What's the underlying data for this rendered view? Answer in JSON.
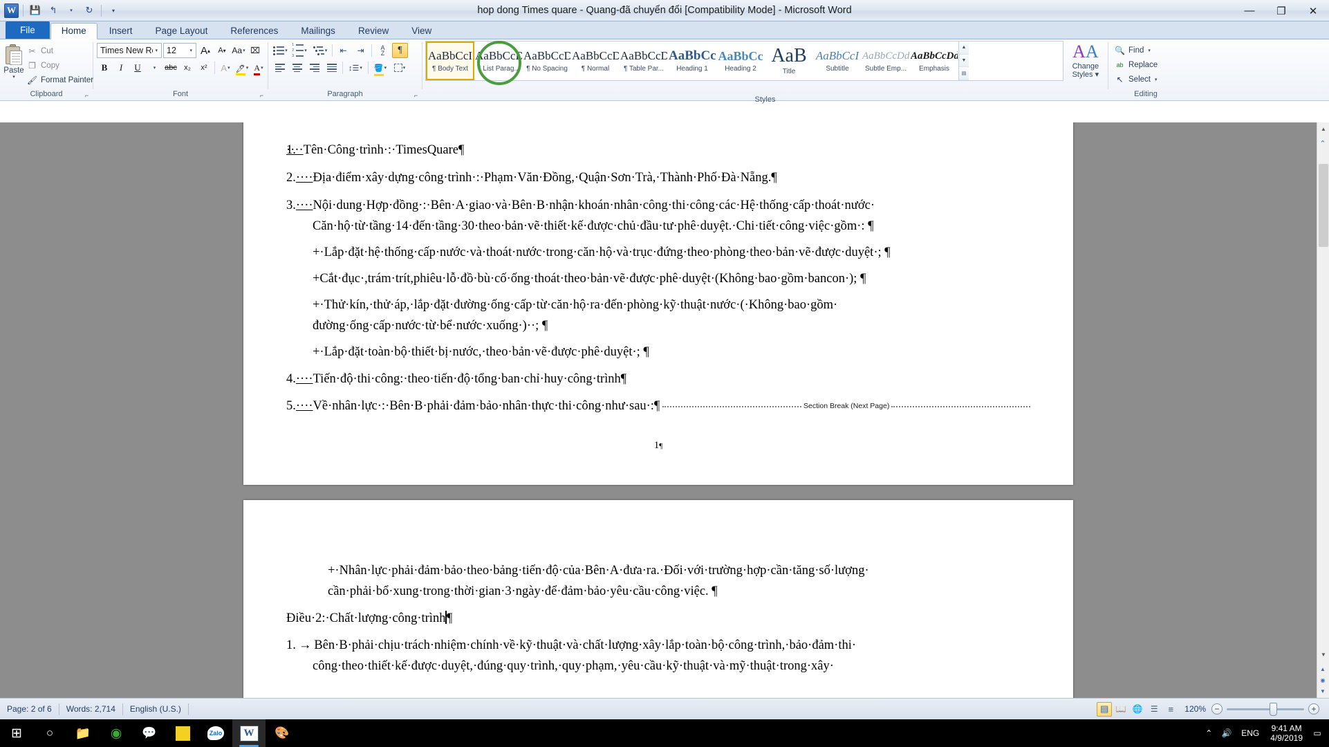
{
  "window": {
    "title": "hop dong Times quare - Quang-đã chuyển đổi [Compatibility Mode]  -  Microsoft Word",
    "minimize": "—",
    "maximize": "❐",
    "close": "✕"
  },
  "quick_access": {
    "app_logo": "W",
    "save": "💾",
    "undo": "↰",
    "undo_caret": "▾",
    "redo": "↻",
    "customize": "▾"
  },
  "tabs": [
    {
      "label": "File",
      "kind": "file"
    },
    {
      "label": "Home",
      "kind": "active"
    },
    {
      "label": "Insert",
      "kind": "normal"
    },
    {
      "label": "Page Layout",
      "kind": "normal"
    },
    {
      "label": "References",
      "kind": "normal"
    },
    {
      "label": "Mailings",
      "kind": "normal"
    },
    {
      "label": "Review",
      "kind": "normal"
    },
    {
      "label": "View",
      "kind": "normal"
    }
  ],
  "ribbon": {
    "clipboard": {
      "group_label": "Clipboard",
      "paste": "Paste",
      "paste_caret": "▾",
      "cut": "Cut",
      "copy": "Copy",
      "format_painter": "Format Painter",
      "cut_icon": "✂",
      "copy_icon": "❐",
      "painter_icon": "🖌",
      "dialog_launcher": "⌐"
    },
    "font": {
      "group_label": "Font",
      "font_name": "Times New Roma",
      "font_size": "12",
      "grow_font": "A",
      "shrink_font": "A",
      "change_case": "Aa",
      "clear_formatting": "⌫",
      "bold": "B",
      "italic": "I",
      "underline": "U",
      "strikethrough": "abc",
      "subscript": "x₂",
      "superscript": "x²",
      "text_effects": "A",
      "highlight": "ab",
      "font_color": "A",
      "dialog_launcher": "⌐"
    },
    "paragraph": {
      "group_label": "Paragraph",
      "bullets": "bullets-icon",
      "numbering": "numbering-icon",
      "multilevel": "multilevel-list-icon",
      "decrease_indent": "decrease-indent-icon",
      "increase_indent": "increase-indent-icon",
      "sort": "A\nZ",
      "show_marks": "¶",
      "align_left": "align-left-icon",
      "align_center": "align-center-icon",
      "align_right": "align-right-icon",
      "justify": "justify-icon",
      "line_spacing": "line-spacing-icon",
      "shading": "shading-icon",
      "borders": "borders-icon",
      "dialog_launcher": "⌐"
    },
    "styles": {
      "group_label": "Styles",
      "items": [
        {
          "preview": "AaBbCcI",
          "name": "¶ Body Text",
          "selected": true,
          "weight": "normal",
          "color": "#1c2b3a",
          "size": "17px"
        },
        {
          "preview": "AaBbCcD",
          "name": "¶ List Parag...",
          "selected": false,
          "weight": "normal",
          "color": "#1c2b3a",
          "size": "17px"
        },
        {
          "preview": "AaBbCcD",
          "name": "¶ No Spacing",
          "selected": false,
          "weight": "normal",
          "color": "#1c2b3a",
          "size": "17px"
        },
        {
          "preview": "AaBbCcD",
          "name": "¶ Normal",
          "selected": false,
          "weight": "normal",
          "color": "#1c2b3a",
          "size": "17px"
        },
        {
          "preview": "AaBbCcD",
          "name": "¶ Table Par...",
          "selected": false,
          "weight": "normal",
          "color": "#1c2b3a",
          "size": "17px"
        },
        {
          "preview": "AaBbCc",
          "name": "Heading 1",
          "selected": false,
          "weight": "bold",
          "color": "#2e5b8c",
          "size": "19px"
        },
        {
          "preview": "AaBbCc",
          "name": "Heading 2",
          "selected": false,
          "weight": "bold",
          "color": "#4a87bf",
          "size": "18px"
        },
        {
          "preview": "AaB",
          "name": "Title",
          "selected": false,
          "weight": "normal",
          "color": "#1f3d63",
          "size": "28px"
        },
        {
          "preview": "AaBbCcI",
          "name": "Subtitle",
          "selected": false,
          "weight": "italic",
          "color": "#4a7fb5",
          "size": "17px"
        },
        {
          "preview": "AaBbCcDd",
          "name": "Subtle Emp...",
          "selected": false,
          "weight": "italic",
          "color": "#9aa7b4",
          "size": "15px"
        },
        {
          "preview": "AaBbCcDd",
          "name": "Emphasis",
          "selected": false,
          "weight": "bold-italic",
          "color": "#1c1c1c",
          "size": "15px"
        }
      ],
      "scroll_up": "▲",
      "scroll_down": "▼",
      "more": "▤",
      "change_styles": "Change\nStyles",
      "change_styles_label_line1": "Change",
      "change_styles_label_line2": "Styles ▾"
    },
    "editing": {
      "group_label": "Editing",
      "find": "Find",
      "find_caret": "▾",
      "replace": "Replace",
      "select": "Select",
      "select_caret": "▾",
      "find_icon": "🔍",
      "replace_icon": "ab",
      "select_icon": "↖"
    }
  },
  "document": {
    "page1": {
      "paragraphs": [
        {
          "num": "1.",
          "tab": "····",
          "text": "Tên·Công·trình·:·TimesQuare",
          "mark": "¶",
          "indent": 0
        },
        {
          "num": "2.",
          "tab": "····",
          "text": "Địa·điểm·xây·dựng·công·trình·:·Phạm·Văn·Đồng,·Quận·Sơn·Trà,·Thành·Phố·Đà·Nẵng.",
          "mark": "¶",
          "indent": 0
        },
        {
          "num": "3.",
          "tab": "····",
          "text": "Nội·dung·Hợp·đồng·:·Bên·A·giao·và·Bên·B·nhận·khoán·nhân·công·thi·công·các·Hệ·thống·cấp·thoát·nước·",
          "mark": "",
          "indent": 0
        },
        {
          "num": "",
          "tab": "",
          "text": "Căn·hộ·từ·tầng·14·đến·tầng·30·theo·bản·vẽ·thiết·kế·được·chủ·đầu·tư·phê·duyệt.·Chi·tiết·công·việc·gồm·:",
          "mark": "¶",
          "indent": 1
        },
        {
          "num": "",
          "tab": "",
          "text": "+·Lắp·đặt·hệ·thống·cấp·nước·và·thoát·nước·trong·căn·hộ·và·trục·đứng·theo·phòng·theo·bản·vẽ·được·duyệt·;",
          "mark": "¶",
          "indent": 1
        },
        {
          "num": "",
          "tab": "",
          "text": "+Cắt·đục·,trám·trít,phiêu·lỗ·đồ·bù·cố·ống·thoát·theo·bản·vẽ·được·phê·duyệt·(Không·bao·gồm·bancon·);",
          "mark": "¶",
          "indent": 1
        },
        {
          "num": "",
          "tab": "",
          "text": "+·Thử·kín,·thử·áp,·lắp·đặt·đường·ống·cấp·từ·căn·hộ·ra·đến·phòng·kỹ·thuật·nước·(·Không·bao·gồm·",
          "mark": "",
          "indent": 1
        },
        {
          "num": "",
          "tab": "",
          "text": "đường·ống·cấp·nước·từ·bể·nước·xuống·)··;",
          "mark": "¶",
          "indent": 1
        },
        {
          "num": "",
          "tab": "",
          "text": "+·Lắp·đặt·toàn·bộ·thiết·bị·nước,·theo·bản·vẽ·được·phê·duyệt·;",
          "mark": "¶",
          "indent": 1
        },
        {
          "num": "4.",
          "tab": "····",
          "text": "Tiến·độ·thi·công:·theo·tiến·độ·tổng·ban·chỉ·huy·công·trình",
          "mark": "¶",
          "indent": 0
        },
        {
          "num": "5.",
          "tab": "····",
          "text": "Về·nhân·lực·:·Bên·B·phải·đảm·bảo·nhân·thực·thi·công·như·sau·:",
          "mark": "¶",
          "indent": 0
        }
      ],
      "section_break_label": "Section Break (Next Page)",
      "page_number": "1"
    },
    "page2": {
      "paragraphs": [
        {
          "num": "",
          "tab": "",
          "text": "+·Nhân·lực·phải·đảm·bảo·theo·bảng·tiến·độ·của·Bên·A·đưa·ra.·Đối·với·trường·hợp·cần·tăng·số·lượng·",
          "mark": "",
          "indent": 1
        },
        {
          "num": "",
          "tab": "",
          "text": "cần·phải·bổ·xung·trong·thời·gian·3·ngày·để·đảm·bảo·yêu·cầu·công·việc.",
          "mark": "¶",
          "indent": 1
        },
        {
          "num": "",
          "tab": "",
          "text": "Điều·2:·Chất·lượng·công·trình",
          "mark": "¶",
          "indent": 0
        },
        {
          "num": "1.",
          "tab": "→",
          "text": "Bên·B·phải·chịu·trách·nhiệm·chính·về·kỹ·thuật·và·chất·lượng·xây·lắp·toàn·bộ·công·trình,·bảo·đảm·thi·",
          "mark": "",
          "indent": 0
        },
        {
          "num": "",
          "tab": "",
          "text": "công·theo·thiết·kế·được·duyệt,·đúng·quy·trình,·quy·phạm,·yêu·cầu·kỹ·thuật·và·mỹ·thuật·trong·xây·",
          "mark": "",
          "indent": 1
        }
      ]
    }
  },
  "status_bar": {
    "page": "Page: 2 of 6",
    "words": "Words: 2,714",
    "language": "English (U.S.)",
    "zoom": "120%",
    "zoom_out": "−",
    "zoom_in": "+",
    "views": [
      {
        "name": "print-layout",
        "glyph": "▤",
        "selected": true
      },
      {
        "name": "full-screen-reading",
        "glyph": "📖",
        "selected": false
      },
      {
        "name": "web-layout",
        "glyph": "🌐",
        "selected": false
      },
      {
        "name": "outline",
        "glyph": "☰",
        "selected": false
      },
      {
        "name": "draft",
        "glyph": "≡",
        "selected": false
      }
    ]
  },
  "taskbar": {
    "start": "⊞",
    "search": "○",
    "items": [
      {
        "name": "file-explorer",
        "glyph": "📁",
        "running": false
      },
      {
        "name": "cdburner-app",
        "glyph": "◉",
        "running": false
      },
      {
        "name": "messenger-app",
        "glyph": "💬",
        "running": false
      },
      {
        "name": "sticky-notes",
        "glyph": "▪",
        "running": false
      },
      {
        "name": "zalo",
        "glyph": "Zalo",
        "running": false
      },
      {
        "name": "word",
        "glyph": "W",
        "running": true
      },
      {
        "name": "paint",
        "glyph": "🎨",
        "running": false
      }
    ],
    "tray": {
      "show_hidden": "⌃",
      "volume": "🔊",
      "language": "ENG",
      "time": "9:41 AM",
      "date": "4/9/2019",
      "notifications": "▭"
    }
  }
}
